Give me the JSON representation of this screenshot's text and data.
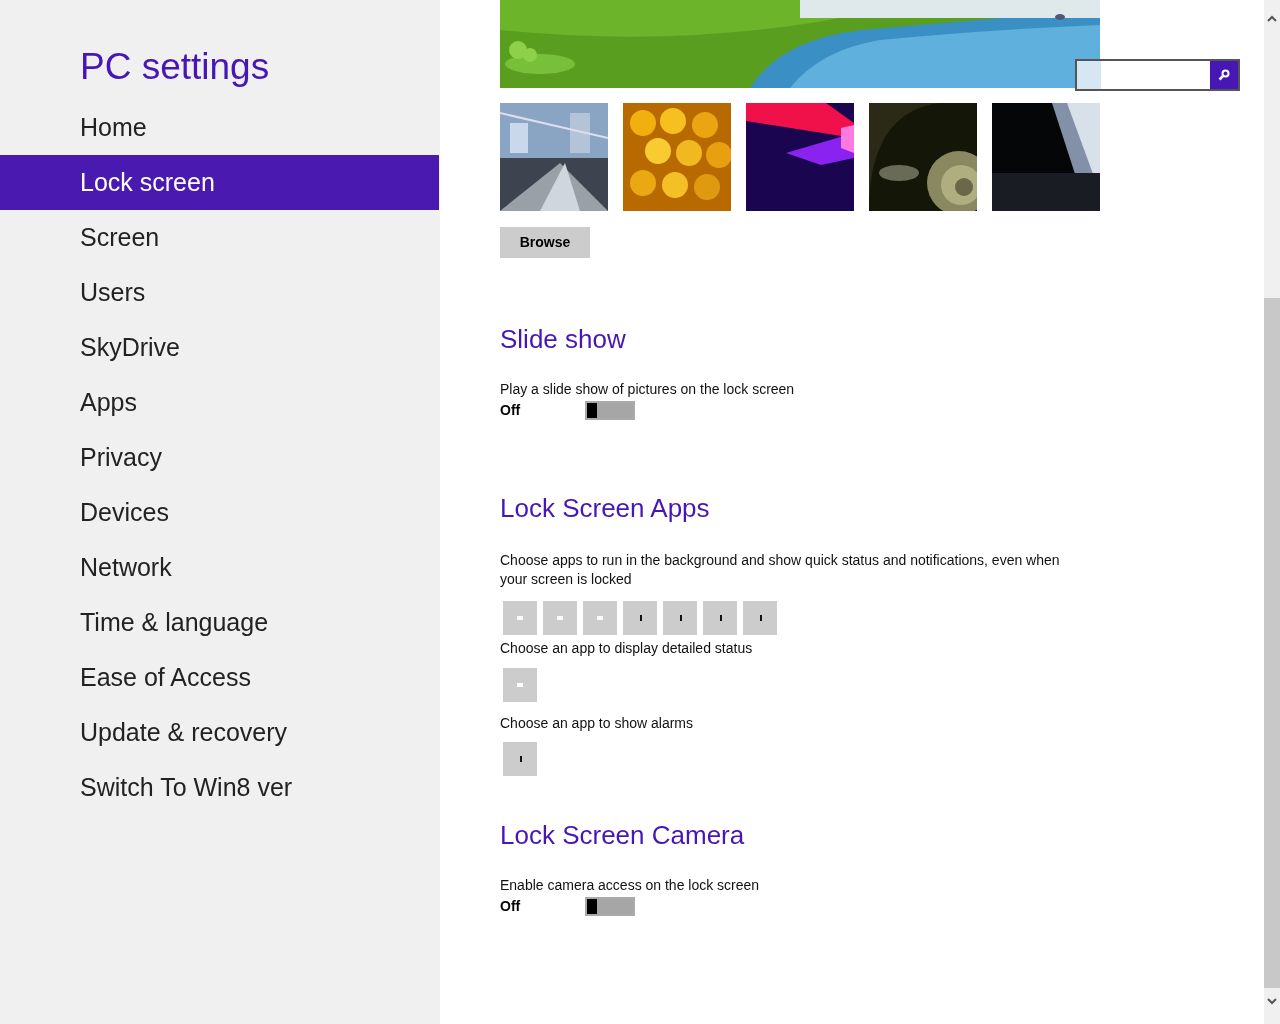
{
  "sidebar": {
    "title": "PC settings",
    "items": [
      {
        "label": "Home",
        "selected": false
      },
      {
        "label": "Lock screen",
        "selected": true
      },
      {
        "label": "Screen",
        "selected": false
      },
      {
        "label": "Users",
        "selected": false
      },
      {
        "label": "SkyDrive",
        "selected": false
      },
      {
        "label": "Apps",
        "selected": false
      },
      {
        "label": "Privacy",
        "selected": false
      },
      {
        "label": "Devices",
        "selected": false
      },
      {
        "label": "Network",
        "selected": false
      },
      {
        "label": "Time & language",
        "selected": false
      },
      {
        "label": "Ease of Access",
        "selected": false
      },
      {
        "label": "Update & recovery",
        "selected": false
      },
      {
        "label": "Switch To Win8 ver",
        "selected": false
      }
    ]
  },
  "browse_button": "Browse",
  "slide_show": {
    "heading": "Slide show",
    "description": "Play a slide show of pictures on the lock screen",
    "toggle": {
      "label": "Off",
      "on": false
    }
  },
  "lock_screen_apps": {
    "heading": "Lock Screen Apps",
    "description": "Choose apps to run in the background and show quick status and notifications, even when your screen is locked",
    "apps": [
      {
        "kind": "light"
      },
      {
        "kind": "light"
      },
      {
        "kind": "light"
      },
      {
        "kind": "dark"
      },
      {
        "kind": "dark"
      },
      {
        "kind": "dark"
      },
      {
        "kind": "dark"
      }
    ],
    "detailed_label": "Choose an app to display detailed status",
    "detailed_apps": [
      {
        "kind": "light"
      }
    ],
    "alarm_label": "Choose an app to show alarms",
    "alarm_apps": [
      {
        "kind": "dark"
      }
    ]
  },
  "lock_screen_camera": {
    "heading": "Lock Screen Camera",
    "description": "Enable camera access on the lock screen",
    "toggle": {
      "label": "Off",
      "on": false
    }
  }
}
